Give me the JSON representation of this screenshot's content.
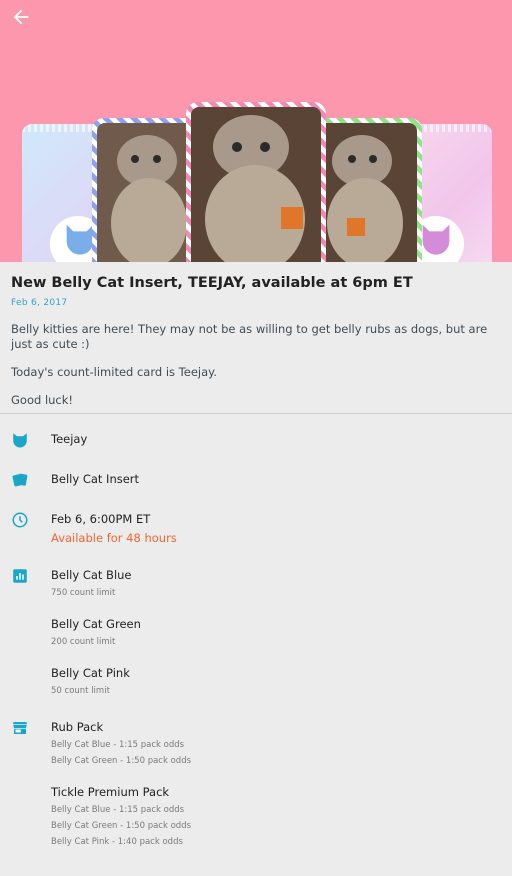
{
  "hero": {
    "background": "#fc97ae"
  },
  "article": {
    "title": "New Belly Cat Insert, TEEJAY, available at 6pm ET",
    "date": "Feb 6, 2017",
    "paragraphs": [
      "Belly kitties are here! They may not be as willing to get belly rubs as dogs, but are just as cute :)",
      "Today's count-limited card is Teejay.",
      "Good luck!"
    ]
  },
  "details": {
    "card_name": "Teejay",
    "set_name": "Belly Cat Insert",
    "release_time": "Feb 6, 6:00PM ET",
    "availability": "Available for 48 hours",
    "variants": [
      {
        "name": "Belly Cat Blue",
        "limit": "750 count limit"
      },
      {
        "name": "Belly Cat Green",
        "limit": "200 count limit"
      },
      {
        "name": "Belly Cat Pink",
        "limit": "50 count limit"
      }
    ],
    "packs": [
      {
        "name": "Rub Pack",
        "odds": [
          "Belly Cat Blue - 1:15 pack odds",
          "Belly Cat Green - 1:50 pack odds"
        ]
      },
      {
        "name": "Tickle Premium Pack",
        "odds": [
          "Belly Cat Blue - 1:15 pack odds",
          "Belly Cat Green - 1:50 pack odds",
          "Belly Cat Pink - 1:40 pack odds"
        ]
      }
    ]
  },
  "colors": {
    "accent": "#2aa6c9",
    "icon": "#1aa6c8",
    "orange": "#f06530"
  },
  "icons": [
    "back-arrow-icon",
    "cat-head-icon",
    "cards-icon",
    "clock-icon",
    "bar-chart-icon",
    "store-icon"
  ]
}
